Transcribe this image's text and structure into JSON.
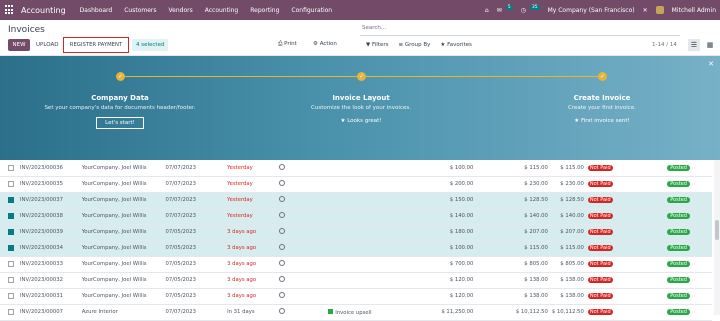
{
  "topbar": {
    "app": "Accounting",
    "menu": [
      "Dashboard",
      "Customers",
      "Vendors",
      "Accounting",
      "Reporting",
      "Configuration"
    ],
    "msg_count": "5",
    "act_count": "35",
    "company": "My Company (San Francisco)",
    "user": "Mitchell Admin"
  },
  "control": {
    "title": "Invoices",
    "new": "NEW",
    "upload": "UPLOAD",
    "register": "REGISTER PAYMENT",
    "selected": "4 selected",
    "search_placeholder": "Search...",
    "print": "Print",
    "action": "Action",
    "filters": "Filters",
    "group_by": "Group By",
    "favorites": "Favorites",
    "pager": "1-14 / 14"
  },
  "banner": {
    "steps": [
      {
        "title": "Company Data",
        "desc": "Set your company's data for documents header/footer.",
        "action": "Let's start!"
      },
      {
        "title": "Invoice Layout",
        "desc": "Customize the look of your invoices.",
        "action": "Looks great!"
      },
      {
        "title": "Create Invoice",
        "desc": "Create your first invoice.",
        "action": "First invoice sent!"
      }
    ]
  },
  "rows": [
    {
      "num": "INV/2023/00036",
      "partner": "YourCompany, Joel Willis",
      "date": "07/07/2023",
      "due": "Yesterday",
      "untaxed": "$ 100.00",
      "total": "$ 115.00",
      "due_amt": "$ 115.00",
      "status": "Not Paid",
      "state": "Posted",
      "sel": false
    },
    {
      "num": "INV/2023/00035",
      "partner": "YourCompany, Joel Willis",
      "date": "07/07/2023",
      "due": "Yesterday",
      "untaxed": "$ 200.00",
      "total": "$ 230.00",
      "due_amt": "$ 230.00",
      "status": "Not Paid",
      "state": "Posted",
      "sel": false
    },
    {
      "num": "INV/2023/00037",
      "partner": "YourCompany, Joel Willis",
      "date": "07/07/2023",
      "due": "Yesterday",
      "untaxed": "$ 150.00",
      "total": "$ 128.50",
      "due_amt": "$ 128.50",
      "status": "Not Paid",
      "state": "Posted",
      "sel": true
    },
    {
      "num": "INV/2023/00038",
      "partner": "YourCompany, Joel Willis",
      "date": "07/07/2023",
      "due": "Yesterday",
      "untaxed": "$ 140.00",
      "total": "$ 140.00",
      "due_amt": "$ 140.00",
      "status": "Not Paid",
      "state": "Posted",
      "sel": true
    },
    {
      "num": "INV/2023/00039",
      "partner": "YourCompany, Joel Willis",
      "date": "07/05/2023",
      "due": "3 days ago",
      "untaxed": "$ 180.00",
      "total": "$ 207.00",
      "due_amt": "$ 207.00",
      "status": "Not Paid",
      "state": "Posted",
      "sel": true
    },
    {
      "num": "INV/2023/00034",
      "partner": "YourCompany, Joel Willis",
      "date": "07/05/2023",
      "due": "3 days ago",
      "untaxed": "$ 100.00",
      "total": "$ 115.00",
      "due_amt": "$ 115.00",
      "status": "Not Paid",
      "state": "Posted",
      "sel": true
    },
    {
      "num": "INV/2023/00033",
      "partner": "YourCompany, Joel Willis",
      "date": "07/05/2023",
      "due": "3 days ago",
      "untaxed": "$ 700.00",
      "total": "$ 805.00",
      "due_amt": "$ 805.00",
      "status": "Not Paid",
      "state": "Posted",
      "sel": false
    },
    {
      "num": "INV/2023/00032",
      "partner": "YourCompany, Joel Willis",
      "date": "07/05/2023",
      "due": "3 days ago",
      "untaxed": "$ 120.00",
      "total": "$ 138.00",
      "due_amt": "$ 138.00",
      "status": "Not Paid",
      "state": "Posted",
      "sel": false
    },
    {
      "num": "INV/2023/00031",
      "partner": "YourCompany, Joel Willis",
      "date": "07/05/2023",
      "due": "3 days ago",
      "untaxed": "$ 120.00",
      "total": "$ 138.00",
      "due_amt": "$ 138.00",
      "status": "Not Paid",
      "state": "Posted",
      "sel": false
    },
    {
      "num": "INV/2023/00007",
      "partner": "Azure Interior",
      "date": "07/07/2023",
      "due": "In 31 days",
      "untaxed": "$ 11,250.00",
      "total": "$ 10,112.50",
      "due_amt": "$ 10,112.50",
      "status": "Not Paid",
      "state": "Posted",
      "sel": false,
      "activity": "Invoice upsell"
    }
  ]
}
